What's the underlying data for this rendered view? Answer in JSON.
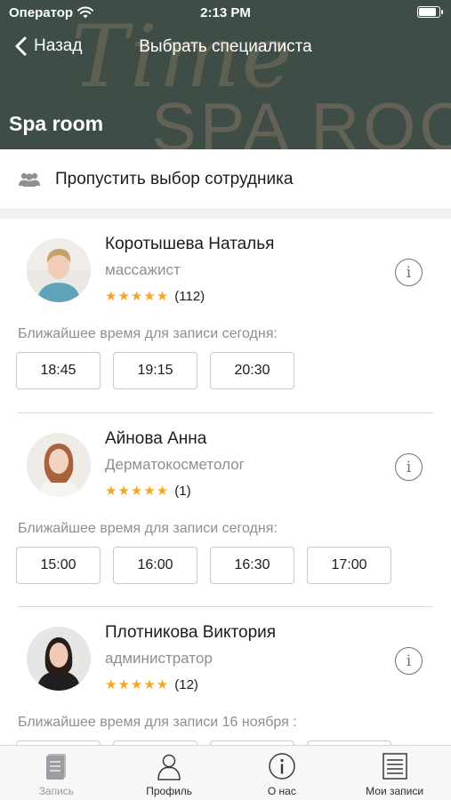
{
  "status_bar": {
    "carrier": "Оператор",
    "time": "2:13 PM"
  },
  "nav": {
    "back_label": "Назад",
    "title": "Выбрать специалиста"
  },
  "header": {
    "salon_name": "Spa room"
  },
  "skip": {
    "label": "Пропустить выбор сотрудника"
  },
  "employees": [
    {
      "name": "Коротышева Наталья",
      "role": "массажист",
      "stars": "★★★★★",
      "reviews": "(112)",
      "slots_label": "Ближайшее время для записи сегодня:",
      "slots": [
        "18:45",
        "19:15",
        "20:30"
      ]
    },
    {
      "name": "Айнова Анна",
      "role": "Дерматокосметолог",
      "stars": "★★★★★",
      "reviews": "(1)",
      "slots_label": "Ближайшее время для записи сегодня:",
      "slots": [
        "15:00",
        "16:00",
        "16:30",
        "17:00"
      ]
    },
    {
      "name": "Плотникова Виктория",
      "role": "администратор",
      "stars": "★★★★★",
      "reviews": "(12)",
      "slots_label": "Ближайшее время для записи 16 ноября :",
      "slots": [
        "",
        "",
        "",
        ""
      ]
    }
  ],
  "tabs": [
    {
      "label": "Запись",
      "icon": "book-icon"
    },
    {
      "label": "Профиль",
      "icon": "profile-icon"
    },
    {
      "label": "О нас",
      "icon": "info-icon"
    },
    {
      "label": "Мои записи",
      "icon": "list-icon"
    }
  ],
  "colors": {
    "header_bg": "#3e4d45",
    "star": "#f5a623",
    "muted_text": "#8e8e93"
  }
}
